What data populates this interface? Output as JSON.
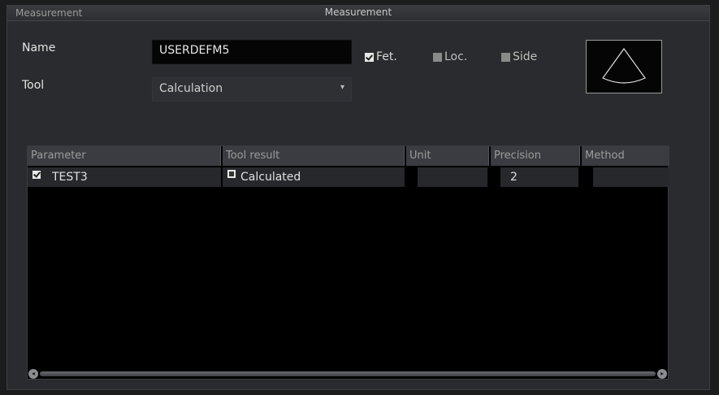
{
  "window": {
    "title": "Measurement",
    "section_label": "Measurement"
  },
  "form": {
    "name_label": "Name",
    "name_value": "USERDEFM5",
    "tool_label": "Tool",
    "tool_value": "Calculation",
    "checkboxes": [
      {
        "label": "Fet.",
        "checked": true
      },
      {
        "label": "Loc.",
        "checked": false
      },
      {
        "label": "Side",
        "checked": false
      }
    ]
  },
  "table": {
    "columns": [
      "Parameter",
      "Tool result",
      "Unit",
      "Precision",
      "Method"
    ],
    "rows": [
      {
        "parameter": "TEST3",
        "tool_result": "Calculated",
        "unit": "",
        "precision": "2",
        "method": ""
      }
    ]
  },
  "icons": {
    "preview": "sector-probe-icon",
    "dropdown": "chevron-down-icon",
    "scroll_left": "scroll-left-icon",
    "scroll_right": "scroll-right-icon"
  }
}
